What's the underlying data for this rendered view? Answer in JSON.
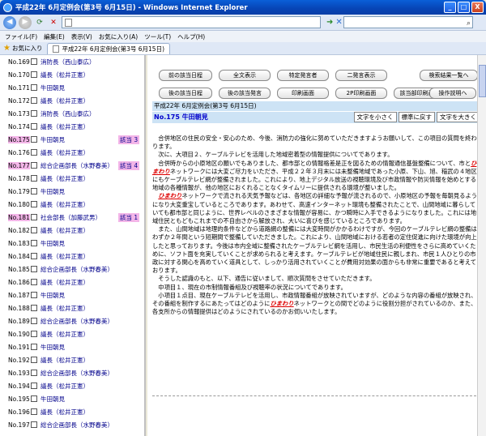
{
  "window": {
    "title": "平成22年 6月定例会(第3号 6月15日) - Windows Internet Explorer",
    "minimize": "_",
    "maximize": "□",
    "close": "X"
  },
  "menu": {
    "items": [
      "ファイル(F)",
      "編集(E)",
      "表示(V)",
      "お気に入り(A)",
      "ツール(T)",
      "ヘルプ(H)"
    ]
  },
  "tabs": {
    "favorites": "お気に入り",
    "active_tab": "平成22年 6月定例会(第3号 6月15日)"
  },
  "list": [
    {
      "num": "No.169",
      "name": "消防長（西山泰広）",
      "badge": ""
    },
    {
      "num": "No.170",
      "name": "議長（松井正憲）",
      "badge": ""
    },
    {
      "num": "No.171",
      "name": "牛田朝見",
      "badge": ""
    },
    {
      "num": "No.172",
      "name": "議長（松井正憲）",
      "badge": ""
    },
    {
      "num": "No.173",
      "name": "消防長（西山泰広）",
      "badge": ""
    },
    {
      "num": "No.174",
      "name": "議長（松井正憲）",
      "badge": ""
    },
    {
      "num": "No.175",
      "name": "牛田朝見",
      "badge": "該当 3",
      "hl": true
    },
    {
      "num": "No.176",
      "name": "議長（松井正憲）",
      "badge": ""
    },
    {
      "num": "No.177",
      "name": "総合企画部長（水野春美）",
      "badge": "該当 4",
      "hl": true
    },
    {
      "num": "No.178",
      "name": "議長（松井正憲）",
      "badge": ""
    },
    {
      "num": "No.179",
      "name": "牛田朝見",
      "badge": ""
    },
    {
      "num": "No.180",
      "name": "議長（松井正憲）",
      "badge": ""
    },
    {
      "num": "No.181",
      "name": "社会部長（加藤武男）",
      "badge": "該当 1",
      "hl": true
    },
    {
      "num": "No.182",
      "name": "議長（松井正憲）",
      "badge": ""
    },
    {
      "num": "No.183",
      "name": "牛田朝見",
      "badge": ""
    },
    {
      "num": "No.184",
      "name": "議長（松井正憲）",
      "badge": ""
    },
    {
      "num": "No.185",
      "name": "総合企画部長（水野春美）",
      "badge": ""
    },
    {
      "num": "No.186",
      "name": "議長（松井正憲）",
      "badge": ""
    },
    {
      "num": "No.187",
      "name": "牛田朝見",
      "badge": ""
    },
    {
      "num": "No.188",
      "name": "議長（松井正憲）",
      "badge": ""
    },
    {
      "num": "No.189",
      "name": "総合企画部長（水野春美）",
      "badge": ""
    },
    {
      "num": "No.190",
      "name": "議長（松井正憲）",
      "badge": ""
    },
    {
      "num": "No.191",
      "name": "牛田朝見",
      "badge": ""
    },
    {
      "num": "No.192",
      "name": "議長（松井正憲）",
      "badge": ""
    },
    {
      "num": "No.193",
      "name": "総合企画部長（水野春美）",
      "badge": ""
    },
    {
      "num": "No.194",
      "name": "議長（松井正憲）",
      "badge": ""
    },
    {
      "num": "No.195",
      "name": "牛田朝見",
      "badge": ""
    },
    {
      "num": "No.196",
      "name": "議長（松井正憲）",
      "badge": ""
    },
    {
      "num": "No.197",
      "name": "総合企画部長（水野春美）",
      "badge": ""
    }
  ],
  "buttons": {
    "prev_meeting": "前の該当日程",
    "full_view": "全文表示",
    "specific_speaker": "特定発言者",
    "two_col": "二発言表示",
    "search_list": "検索結果一覧へ",
    "next_meeting": "後の該当日程",
    "next_speech": "後の該当発言",
    "print_screen": "印刷画面",
    "print_2p": "2P印刷画面",
    "print_matching": "該当部印刷画面",
    "help": "操作説明へ"
  },
  "header": {
    "meeting": "平成22年 6月定例会(第3号 6月15日)",
    "speaker": "No.175 牛田朝見",
    "font_small": "文字を小さく",
    "font_std": "標準に戻す",
    "font_large": "文字を大きく"
  },
  "body": {
    "p1": "　合併地区の住民の安全・安心のため、今後、消防力の強化に努めていただきますようお願いして、この項目の質問を終わります。",
    "p2": "　次に、大項目２、ケーブルテレビを活用した地域密着型の情報提供についてであります。",
    "p3a": "　合併時からの小原地区の願いでもありました、都市部との情報格差是正を図るための情報通信基盤整備について、市と",
    "kw": "ひまわり",
    "p3b": "ネットワークには大変ご尽力をいただき、平成２２年３月末には未整備地域であった小原、下山、旭、稲武の４地区にもケーブルテレビ網が整備されました。これにより、地上デジタル放送の視聴環境及び市政情報や防災情報を始めとする地域の各種情報が、他の地区におくれることなくタイムリーに提供される環境が整いました。",
    "p4a": "　",
    "p4b": "ネットワークで流される天気予報などは、各地区の詳細な予報が流されるので、小原地区の予報を毎朝見るようになり大変重宝しているところであります。あわせて、高速インターネット環境も整備されたことで、山間地域に暮らしていても都市部と同じように、世界レベルのさまざまな情報が容易に、かつ瞬時に入手できるようになりました。これには地域住民ともどもこれまでの不自由さから解放され、大いに喜びを感じているところであります。",
    "p5": "　また、山間地域は地理的条件などから道路網の整備には大変時間がかかるわけですが、今回のケーブルテレビ網の整備はわずか２年間という短期間で整備していただきました。これにより、山間地域における若者の定住促進に向けた環境が向上したと思っております。今後は市内全域に整備されたケーブルテレビ網を活用し、市民生活の利便性をさらに高めていくために、ソフト面を充実していくことが求められると考えます。ケーブルテレビが地域住民に親しまれ、市民１人ひとりの市政に対する関心を高めていく道具として、しっかり活用されていくことが費用対効果の面からも非常に重要であると考えております。",
    "p6": "　そうした認識のもと、以下、通告に従いまして、順次質問をさせていただきます。",
    "p7": "　中項目１、現在の市制情報番組及び視聴率の状況についてであります。",
    "p8a": "　小項目１点目、現在ケーブルテレビを活用し、市政情報番組が放映されていますが、どのような内容の番組が放映され、その番組を制作するにあたってはどのように",
    "p8b": "ネットワークとの間でどのように役割分担がされているのか、また、各支所からの情報提供はどのようにされているのかお伺いいたします。"
  }
}
